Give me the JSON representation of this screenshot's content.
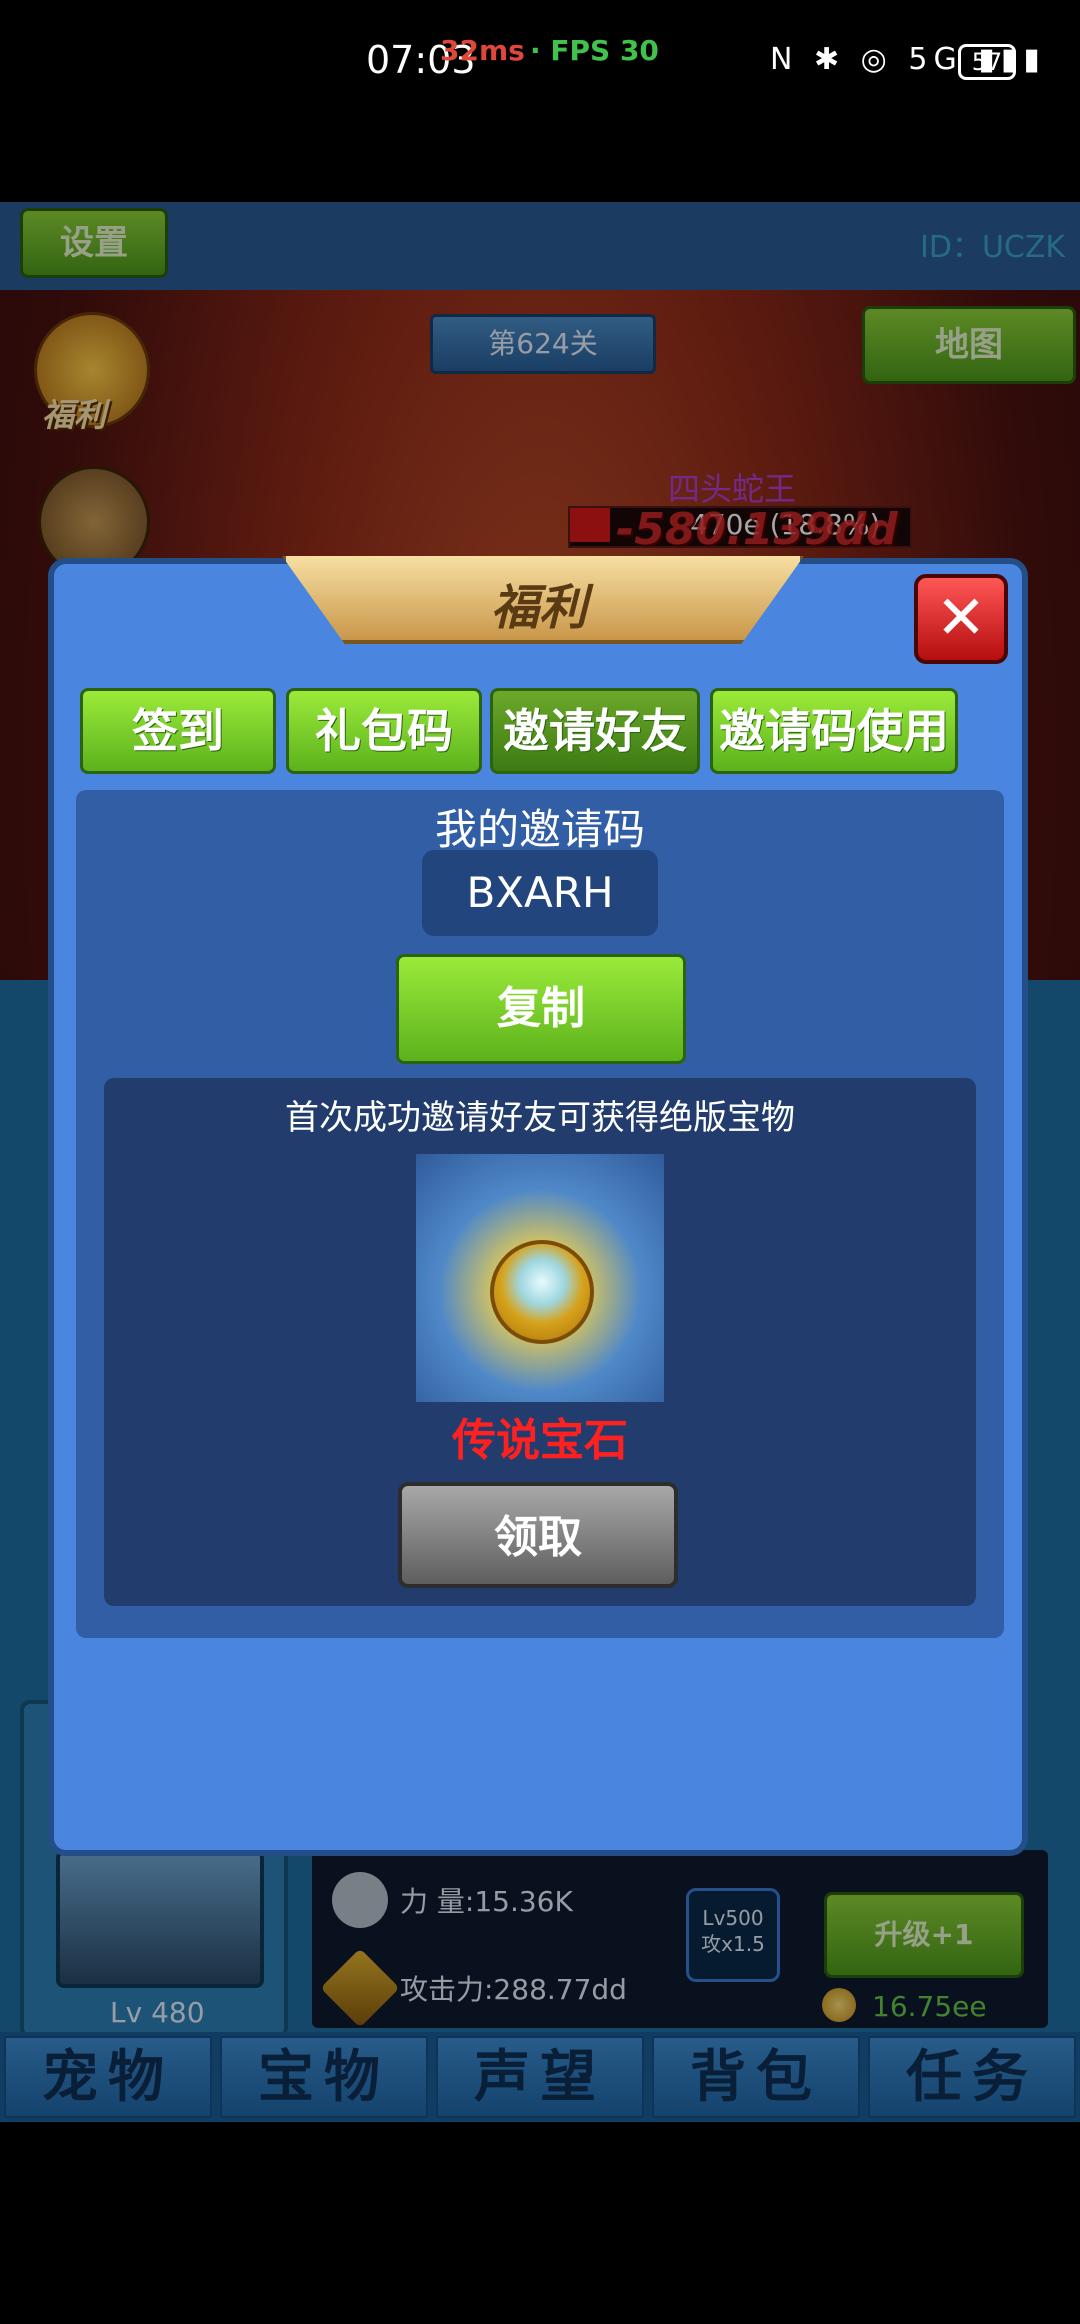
{
  "status_bar": {
    "time": "07:03",
    "perf": "32ms",
    "fps": "· FPS 30",
    "icons": "N ✱ ◎ 5G ▮▮▮",
    "battery": "57"
  },
  "game": {
    "settings_label": "设置",
    "player_id": "ID：UCZK",
    "map_label": "地图",
    "level": "第624关",
    "welfare_label": "福利",
    "boss_name": "四头蛇王",
    "boss_hp_text": "470e (18.8%)",
    "damage_text": "-580.139dd"
  },
  "modal": {
    "title": "福利",
    "close_symbol": "✕",
    "tabs": [
      {
        "label": "签到"
      },
      {
        "label": "礼包码"
      },
      {
        "label": "邀请好友"
      },
      {
        "label": "邀请码使用"
      }
    ],
    "mycode_label": "我的邀请码",
    "invite_code": "BXARH",
    "copy_label": "复制",
    "reward_desc": "首次成功邀请好友可获得绝版宝物",
    "reward_name": "传说宝石",
    "claim_label": "领取"
  },
  "pet": {
    "level": "Lv 480",
    "power": "力  量:15.36K",
    "attack": "攻击力:288.77dd",
    "skill_level": "Lv500",
    "skill_bonus": "攻x1.5",
    "upgrade_label": "升级+1",
    "coin_value": "16.75ee"
  },
  "bottom_nav": [
    {
      "label": "宠物"
    },
    {
      "label": "宝物"
    },
    {
      "label": "声望"
    },
    {
      "label": "背包"
    },
    {
      "label": "任务"
    }
  ]
}
